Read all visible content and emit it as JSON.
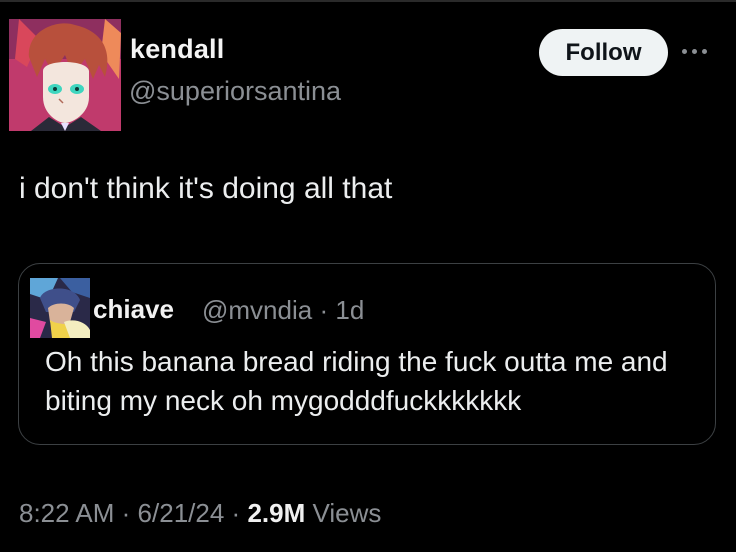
{
  "author": {
    "name": "kendall",
    "handle": "@superiorsantina"
  },
  "actions": {
    "follow_label": "Follow",
    "more_icon": "more-horizontal-icon"
  },
  "tweet": {
    "text": "i don't think it's doing all that"
  },
  "quoted": {
    "name": "chiave",
    "handle": "@mvndia",
    "separator": "·",
    "age": "1d",
    "text": "Oh this banana bread riding the fuck outta me and biting my neck oh mygodddfuckkkkkkk"
  },
  "meta": {
    "time": "8:22 AM",
    "date": "6/21/24",
    "views_count": "2.9M",
    "views_label": "Views",
    "separator": "·"
  },
  "colors": {
    "background": "#000000",
    "text_primary": "#e7e9ea",
    "text_secondary": "#8b8f94",
    "follow_bg": "#eff3f4",
    "card_border": "#3c4043"
  }
}
